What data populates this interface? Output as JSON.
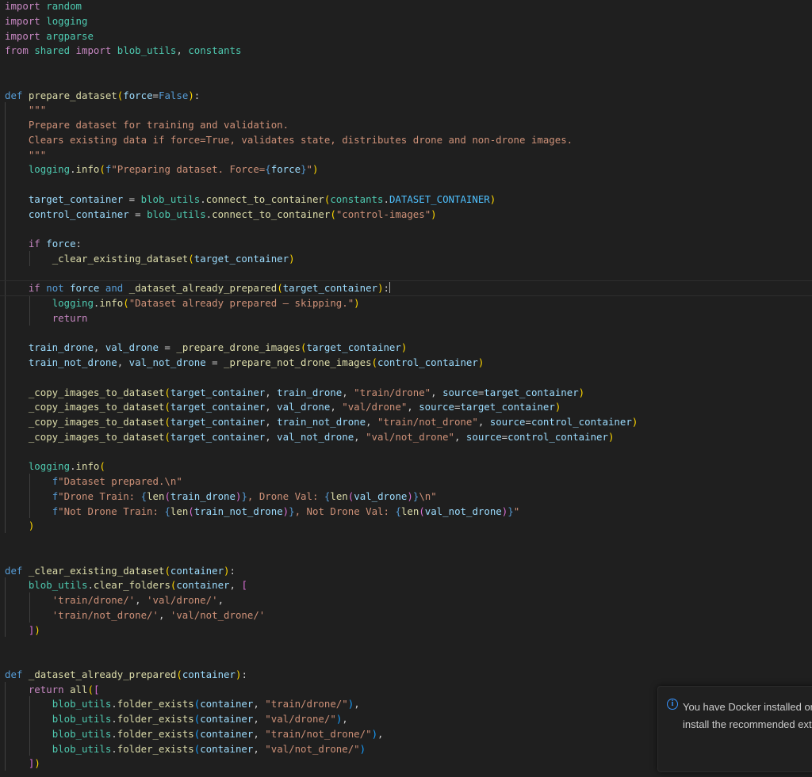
{
  "editor": {
    "language": "python",
    "lines": [
      [
        [
          "c",
          "import"
        ],
        [
          "p",
          " "
        ],
        [
          "m",
          "random"
        ]
      ],
      [
        [
          "c",
          "import"
        ],
        [
          "p",
          " "
        ],
        [
          "m",
          "logging"
        ]
      ],
      [
        [
          "c",
          "import"
        ],
        [
          "p",
          " "
        ],
        [
          "m",
          "argparse"
        ]
      ],
      [
        [
          "c",
          "from"
        ],
        [
          "p",
          " "
        ],
        [
          "m",
          "shared"
        ],
        [
          "p",
          " "
        ],
        [
          "c",
          "import"
        ],
        [
          "p",
          " "
        ],
        [
          "m",
          "blob_utils"
        ],
        [
          "p",
          ", "
        ],
        [
          "m",
          "constants"
        ]
      ],
      [],
      [],
      [
        [
          "k",
          "def"
        ],
        [
          "p",
          " "
        ],
        [
          "f",
          "prepare_dataset"
        ],
        [
          "b1",
          "("
        ],
        [
          "v",
          "force"
        ],
        [
          "p",
          "="
        ],
        [
          "k",
          "False"
        ],
        [
          "b1",
          ")"
        ],
        [
          "p",
          ":"
        ]
      ],
      [
        [
          "p",
          "    "
        ],
        [
          "s",
          "\"\"\""
        ]
      ],
      [
        [
          "p",
          "    "
        ],
        [
          "s",
          "Prepare dataset for training and validation."
        ]
      ],
      [
        [
          "p",
          "    "
        ],
        [
          "s",
          "Clears existing data if force=True, validates state, distributes drone and non-drone images."
        ]
      ],
      [
        [
          "p",
          "    "
        ],
        [
          "s",
          "\"\"\""
        ]
      ],
      [
        [
          "p",
          "    "
        ],
        [
          "m",
          "logging"
        ],
        [
          "p",
          "."
        ],
        [
          "f",
          "info"
        ],
        [
          "b1",
          "("
        ],
        [
          "k",
          "f"
        ],
        [
          "s",
          "\"Preparing dataset. Force="
        ],
        [
          "k",
          "{"
        ],
        [
          "v",
          "force"
        ],
        [
          "k",
          "}"
        ],
        [
          "s",
          "\""
        ],
        [
          "b1",
          ")"
        ]
      ],
      [],
      [
        [
          "p",
          "    "
        ],
        [
          "v",
          "target_container"
        ],
        [
          "p",
          " = "
        ],
        [
          "m",
          "blob_utils"
        ],
        [
          "p",
          "."
        ],
        [
          "f",
          "connect_to_container"
        ],
        [
          "b1",
          "("
        ],
        [
          "m",
          "constants"
        ],
        [
          "p",
          "."
        ],
        [
          "n",
          "DATASET_CONTAINER"
        ],
        [
          "b1",
          ")"
        ]
      ],
      [
        [
          "p",
          "    "
        ],
        [
          "v",
          "control_container"
        ],
        [
          "p",
          " = "
        ],
        [
          "m",
          "blob_utils"
        ],
        [
          "p",
          "."
        ],
        [
          "f",
          "connect_to_container"
        ],
        [
          "b1",
          "("
        ],
        [
          "s",
          "\"control-images\""
        ],
        [
          "b1",
          ")"
        ]
      ],
      [],
      [
        [
          "p",
          "    "
        ],
        [
          "c",
          "if"
        ],
        [
          "p",
          " "
        ],
        [
          "v",
          "force"
        ],
        [
          "p",
          ":"
        ]
      ],
      [
        [
          "p",
          "        "
        ],
        [
          "f",
          "_clear_existing_dataset"
        ],
        [
          "b1",
          "("
        ],
        [
          "v",
          "target_container"
        ],
        [
          "b1",
          ")"
        ]
      ],
      [],
      [
        [
          "p",
          "    "
        ],
        [
          "c",
          "if"
        ],
        [
          "p",
          " "
        ],
        [
          "k",
          "not"
        ],
        [
          "p",
          " "
        ],
        [
          "v",
          "force"
        ],
        [
          "p",
          " "
        ],
        [
          "k",
          "and"
        ],
        [
          "p",
          " "
        ],
        [
          "f",
          "_dataset_already_prepared"
        ],
        [
          "b1",
          "("
        ],
        [
          "v",
          "target_container"
        ],
        [
          "b1",
          ")"
        ],
        [
          "p",
          ":"
        ],
        [
          "cursor",
          ""
        ]
      ],
      [
        [
          "p",
          "        "
        ],
        [
          "m",
          "logging"
        ],
        [
          "p",
          "."
        ],
        [
          "f",
          "info"
        ],
        [
          "b1",
          "("
        ],
        [
          "s",
          "\"Dataset already prepared — skipping.\""
        ],
        [
          "b1",
          ")"
        ]
      ],
      [
        [
          "p",
          "        "
        ],
        [
          "c",
          "return"
        ]
      ],
      [],
      [
        [
          "p",
          "    "
        ],
        [
          "v",
          "train_drone"
        ],
        [
          "p",
          ", "
        ],
        [
          "v",
          "val_drone"
        ],
        [
          "p",
          " = "
        ],
        [
          "f",
          "_prepare_drone_images"
        ],
        [
          "b1",
          "("
        ],
        [
          "v",
          "target_container"
        ],
        [
          "b1",
          ")"
        ]
      ],
      [
        [
          "p",
          "    "
        ],
        [
          "v",
          "train_not_drone"
        ],
        [
          "p",
          ", "
        ],
        [
          "v",
          "val_not_drone"
        ],
        [
          "p",
          " = "
        ],
        [
          "f",
          "_prepare_not_drone_images"
        ],
        [
          "b1",
          "("
        ],
        [
          "v",
          "control_container"
        ],
        [
          "b1",
          ")"
        ]
      ],
      [],
      [
        [
          "p",
          "    "
        ],
        [
          "f",
          "_copy_images_to_dataset"
        ],
        [
          "b1",
          "("
        ],
        [
          "v",
          "target_container"
        ],
        [
          "p",
          ", "
        ],
        [
          "v",
          "train_drone"
        ],
        [
          "p",
          ", "
        ],
        [
          "s",
          "\"train/drone\""
        ],
        [
          "p",
          ", "
        ],
        [
          "v",
          "source"
        ],
        [
          "p",
          "="
        ],
        [
          "v",
          "target_container"
        ],
        [
          "b1",
          ")"
        ]
      ],
      [
        [
          "p",
          "    "
        ],
        [
          "f",
          "_copy_images_to_dataset"
        ],
        [
          "b1",
          "("
        ],
        [
          "v",
          "target_container"
        ],
        [
          "p",
          ", "
        ],
        [
          "v",
          "val_drone"
        ],
        [
          "p",
          ", "
        ],
        [
          "s",
          "\"val/drone\""
        ],
        [
          "p",
          ", "
        ],
        [
          "v",
          "source"
        ],
        [
          "p",
          "="
        ],
        [
          "v",
          "target_container"
        ],
        [
          "b1",
          ")"
        ]
      ],
      [
        [
          "p",
          "    "
        ],
        [
          "f",
          "_copy_images_to_dataset"
        ],
        [
          "b1",
          "("
        ],
        [
          "v",
          "target_container"
        ],
        [
          "p",
          ", "
        ],
        [
          "v",
          "train_not_drone"
        ],
        [
          "p",
          ", "
        ],
        [
          "s",
          "\"train/not_drone\""
        ],
        [
          "p",
          ", "
        ],
        [
          "v",
          "source"
        ],
        [
          "p",
          "="
        ],
        [
          "v",
          "control_container"
        ],
        [
          "b1",
          ")"
        ]
      ],
      [
        [
          "p",
          "    "
        ],
        [
          "f",
          "_copy_images_to_dataset"
        ],
        [
          "b1",
          "("
        ],
        [
          "v",
          "target_container"
        ],
        [
          "p",
          ", "
        ],
        [
          "v",
          "val_not_drone"
        ],
        [
          "p",
          ", "
        ],
        [
          "s",
          "\"val/not_drone\""
        ],
        [
          "p",
          ", "
        ],
        [
          "v",
          "source"
        ],
        [
          "p",
          "="
        ],
        [
          "v",
          "control_container"
        ],
        [
          "b1",
          ")"
        ]
      ],
      [],
      [
        [
          "p",
          "    "
        ],
        [
          "m",
          "logging"
        ],
        [
          "p",
          "."
        ],
        [
          "f",
          "info"
        ],
        [
          "b1",
          "("
        ]
      ],
      [
        [
          "p",
          "        "
        ],
        [
          "k",
          "f"
        ],
        [
          "s",
          "\"Dataset prepared.\\n\""
        ]
      ],
      [
        [
          "p",
          "        "
        ],
        [
          "k",
          "f"
        ],
        [
          "s",
          "\"Drone Train: "
        ],
        [
          "k",
          "{"
        ],
        [
          "f",
          "len"
        ],
        [
          "b2",
          "("
        ],
        [
          "v",
          "train_drone"
        ],
        [
          "b2",
          ")"
        ],
        [
          "k",
          "}"
        ],
        [
          "s",
          ", Drone Val: "
        ],
        [
          "k",
          "{"
        ],
        [
          "f",
          "len"
        ],
        [
          "b2",
          "("
        ],
        [
          "v",
          "val_drone"
        ],
        [
          "b2",
          ")"
        ],
        [
          "k",
          "}"
        ],
        [
          "s",
          "\\n\""
        ]
      ],
      [
        [
          "p",
          "        "
        ],
        [
          "k",
          "f"
        ],
        [
          "s",
          "\"Not Drone Train: "
        ],
        [
          "k",
          "{"
        ],
        [
          "f",
          "len"
        ],
        [
          "b2",
          "("
        ],
        [
          "v",
          "train_not_drone"
        ],
        [
          "b2",
          ")"
        ],
        [
          "k",
          "}"
        ],
        [
          "s",
          ", Not Drone Val: "
        ],
        [
          "k",
          "{"
        ],
        [
          "f",
          "len"
        ],
        [
          "b2",
          "("
        ],
        [
          "v",
          "val_not_drone"
        ],
        [
          "b2",
          ")"
        ],
        [
          "k",
          "}"
        ],
        [
          "s",
          "\""
        ]
      ],
      [
        [
          "p",
          "    "
        ],
        [
          "b1",
          ")"
        ]
      ],
      [],
      [],
      [
        [
          "k",
          "def"
        ],
        [
          "p",
          " "
        ],
        [
          "f",
          "_clear_existing_dataset"
        ],
        [
          "b1",
          "("
        ],
        [
          "v",
          "container"
        ],
        [
          "b1",
          ")"
        ],
        [
          "p",
          ":"
        ]
      ],
      [
        [
          "p",
          "    "
        ],
        [
          "m",
          "blob_utils"
        ],
        [
          "p",
          "."
        ],
        [
          "f",
          "clear_folders"
        ],
        [
          "b1",
          "("
        ],
        [
          "v",
          "container"
        ],
        [
          "p",
          ", "
        ],
        [
          "b2",
          "["
        ]
      ],
      [
        [
          "p",
          "        "
        ],
        [
          "s",
          "'train/drone/'"
        ],
        [
          "p",
          ", "
        ],
        [
          "s",
          "'val/drone/'"
        ],
        [
          "p",
          ","
        ]
      ],
      [
        [
          "p",
          "        "
        ],
        [
          "s",
          "'train/not_drone/'"
        ],
        [
          "p",
          ", "
        ],
        [
          "s",
          "'val/not_drone/'"
        ]
      ],
      [
        [
          "p",
          "    "
        ],
        [
          "b2",
          "]"
        ],
        [
          "b1",
          ")"
        ]
      ],
      [],
      [],
      [
        [
          "k",
          "def"
        ],
        [
          "p",
          " "
        ],
        [
          "f",
          "_dataset_already_prepared"
        ],
        [
          "b1",
          "("
        ],
        [
          "v",
          "container"
        ],
        [
          "b1",
          ")"
        ],
        [
          "p",
          ":"
        ]
      ],
      [
        [
          "p",
          "    "
        ],
        [
          "c",
          "return"
        ],
        [
          "p",
          " "
        ],
        [
          "f",
          "all"
        ],
        [
          "b1",
          "("
        ],
        [
          "b2",
          "["
        ]
      ],
      [
        [
          "p",
          "        "
        ],
        [
          "m",
          "blob_utils"
        ],
        [
          "p",
          "."
        ],
        [
          "f",
          "folder_exists"
        ],
        [
          "b3",
          "("
        ],
        [
          "v",
          "container"
        ],
        [
          "p",
          ", "
        ],
        [
          "s",
          "\"train/drone/\""
        ],
        [
          "b3",
          ")"
        ],
        [
          "p",
          ","
        ]
      ],
      [
        [
          "p",
          "        "
        ],
        [
          "m",
          "blob_utils"
        ],
        [
          "p",
          "."
        ],
        [
          "f",
          "folder_exists"
        ],
        [
          "b3",
          "("
        ],
        [
          "v",
          "container"
        ],
        [
          "p",
          ", "
        ],
        [
          "s",
          "\"val/drone/\""
        ],
        [
          "b3",
          ")"
        ],
        [
          "p",
          ","
        ]
      ],
      [
        [
          "p",
          "        "
        ],
        [
          "m",
          "blob_utils"
        ],
        [
          "p",
          "."
        ],
        [
          "f",
          "folder_exists"
        ],
        [
          "b3",
          "("
        ],
        [
          "v",
          "container"
        ],
        [
          "p",
          ", "
        ],
        [
          "s",
          "\"train/not_drone/\""
        ],
        [
          "b3",
          ")"
        ],
        [
          "p",
          ","
        ]
      ],
      [
        [
          "p",
          "        "
        ],
        [
          "m",
          "blob_utils"
        ],
        [
          "p",
          "."
        ],
        [
          "f",
          "folder_exists"
        ],
        [
          "b3",
          "("
        ],
        [
          "v",
          "container"
        ],
        [
          "p",
          ", "
        ],
        [
          "s",
          "\"val/not_drone/\""
        ],
        [
          "b3",
          ")"
        ]
      ],
      [
        [
          "p",
          "    "
        ],
        [
          "b2",
          "]"
        ],
        [
          "b1",
          ")"
        ]
      ]
    ],
    "current_line_index": 19
  },
  "notification": {
    "icon": "info-icon",
    "icon_glyph": "i",
    "line1": "You have Docker installed on",
    "line2": "install the recommended exte"
  },
  "colors": {
    "background": "#1f1f1f",
    "keyword": "#569cd6",
    "control_keyword": "#c586c0",
    "function": "#dcdcaa",
    "variable": "#9cdcfe",
    "string": "#ce9178",
    "module": "#4ec9b0",
    "constant": "#4fc1ff",
    "info_accent": "#3794ff"
  }
}
